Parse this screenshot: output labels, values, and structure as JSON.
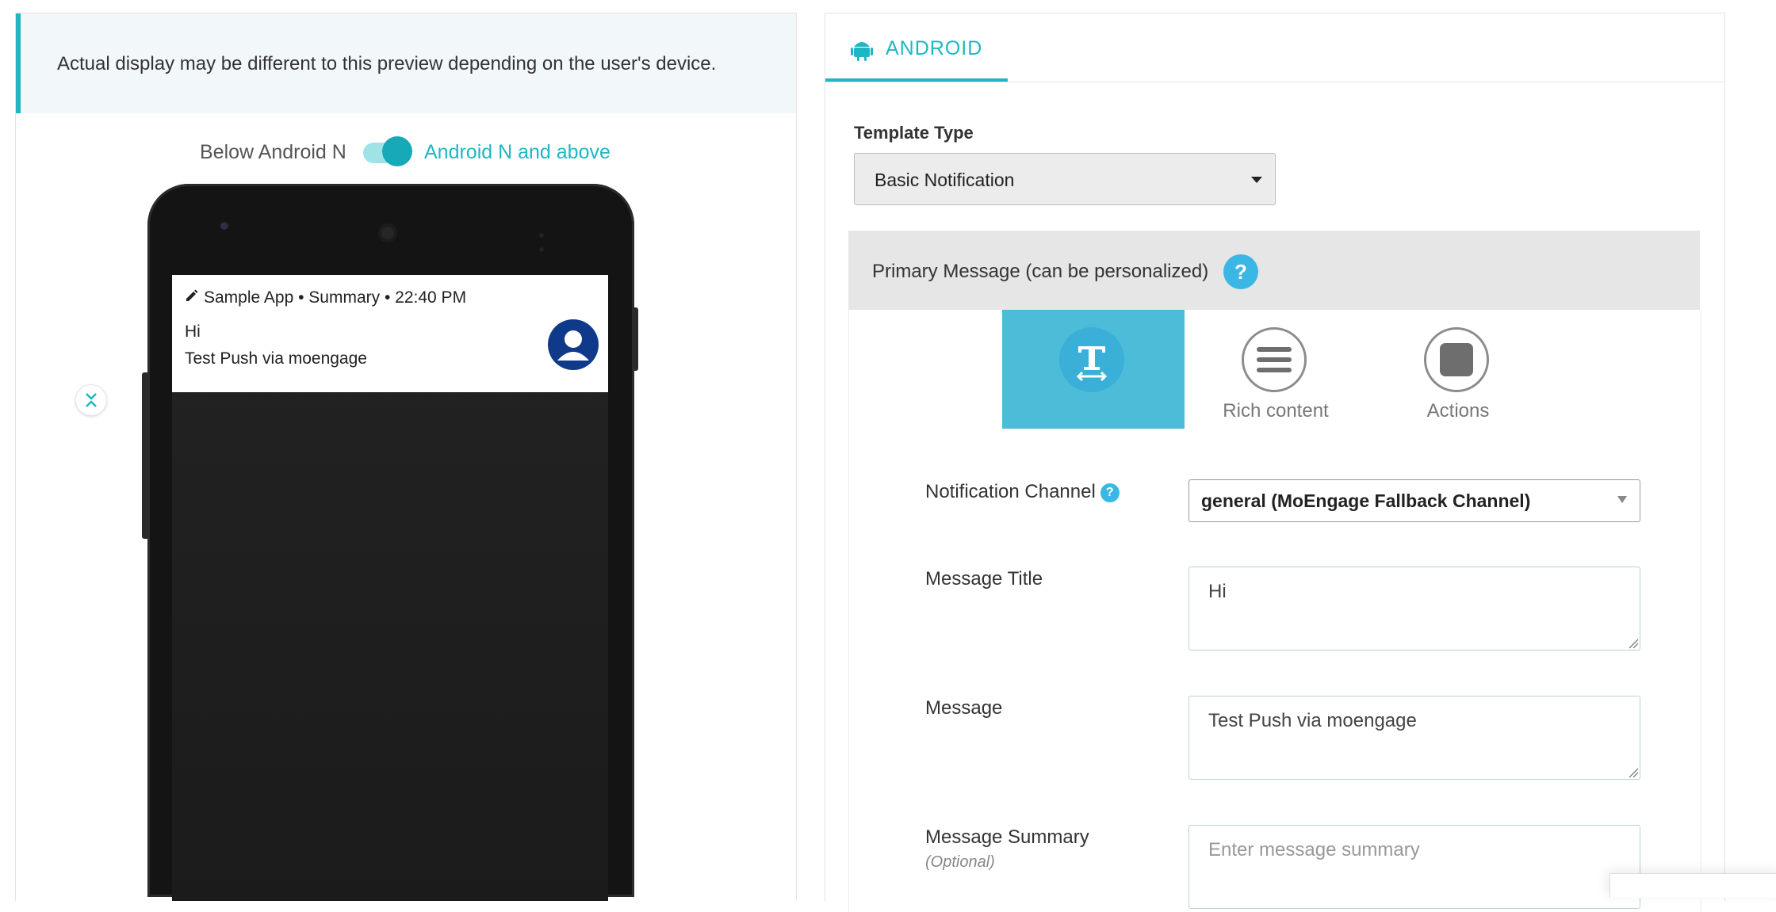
{
  "preview": {
    "banner": "Actual display may be different to this preview depending on the user's device.",
    "toggle_left_label": "Below Android N",
    "toggle_right_label": "Android N and above",
    "toggle_on": true,
    "notification": {
      "app_name": "Sample App",
      "summary": "Summary",
      "time": "22:40 PM",
      "title": "Hi",
      "message": "Test Push via moengage"
    }
  },
  "editor": {
    "tab_label": "ANDROID",
    "template_type_label": "Template Type",
    "template_type_value": "Basic Notification",
    "primary_message_label": "Primary Message (can be personalized)",
    "help_glyph": "?",
    "content_types": [
      {
        "label": "",
        "icon": "text-format-icon",
        "active": true
      },
      {
        "label": "Rich content",
        "icon": "list-lines-icon",
        "active": false
      },
      {
        "label": "Actions",
        "icon": "square-icon",
        "active": false
      }
    ],
    "fields": {
      "channel_label": "Notification Channel",
      "channel_value": "general (MoEngage Fallback Channel)",
      "title_label": "Message Title",
      "title_value": "Hi",
      "message_label": "Message",
      "message_value": "Test Push via moengage",
      "summary_label": "Message Summary",
      "summary_optional": "(Optional)",
      "summary_placeholder": "Enter message summary"
    }
  },
  "colors": {
    "accent": "#1fb6c4",
    "help_blue": "#3bb7e5",
    "active_type": "#4cbcd9"
  }
}
